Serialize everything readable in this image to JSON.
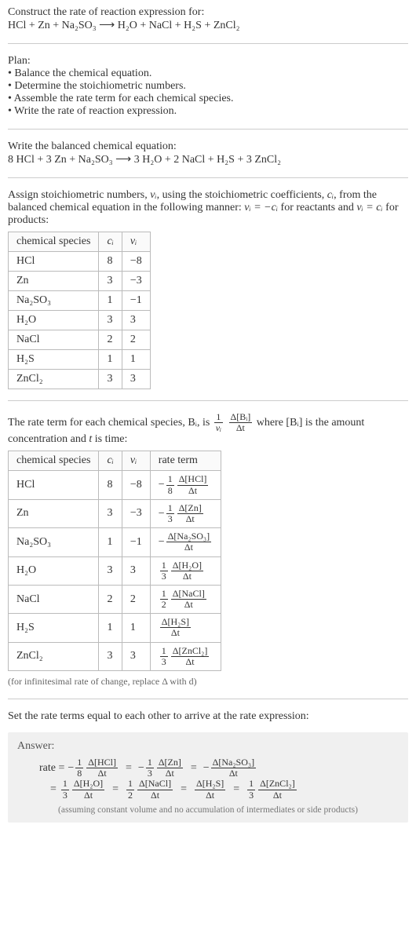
{
  "header": {
    "intro": "Construct the rate of reaction expression for:",
    "equation": "HCl + Zn + Na₂SO₃  ⟶  H₂O + NaCl + H₂S + ZnCl₂"
  },
  "plan": {
    "title": "Plan:",
    "items": [
      "• Balance the chemical equation.",
      "• Determine the stoichiometric numbers.",
      "• Assemble the rate term for each chemical species.",
      "• Write the rate of reaction expression."
    ]
  },
  "balanced": {
    "title": "Write the balanced chemical equation:",
    "equation": "8 HCl + 3 Zn + Na₂SO₃  ⟶  3 H₂O + 2 NaCl + H₂S + 3 ZnCl₂"
  },
  "stoich_text": {
    "line1a": "Assign stoichiometric numbers, ",
    "line1b": ", using the stoichiometric coefficients, ",
    "line1c": ", from the balanced chemical equation in the following manner: ",
    "line1d": " for reactants and ",
    "line1e": " for products:",
    "nu_i": "νᵢ",
    "c_i": "cᵢ",
    "eq1": "νᵢ = −cᵢ",
    "eq2": "νᵢ = cᵢ"
  },
  "table1": {
    "headers": [
      "chemical species",
      "cᵢ",
      "νᵢ"
    ],
    "rows": [
      {
        "sp": "HCl",
        "c": "8",
        "n": "−8"
      },
      {
        "sp": "Zn",
        "c": "3",
        "n": "−3"
      },
      {
        "sp": "Na₂SO₃",
        "c": "1",
        "n": "−1"
      },
      {
        "sp": "H₂O",
        "c": "3",
        "n": "3"
      },
      {
        "sp": "NaCl",
        "c": "2",
        "n": "2"
      },
      {
        "sp": "H₂S",
        "c": "1",
        "n": "1"
      },
      {
        "sp": "ZnCl₂",
        "c": "3",
        "n": "3"
      }
    ]
  },
  "rate_text": {
    "a": "The rate term for each chemical species, Bᵢ, is ",
    "b": " where [Bᵢ] is the amount concentration and ",
    "t": "t",
    "c": " is time:"
  },
  "rate_frac": {
    "outer_num": "1",
    "outer_den": "νᵢ",
    "inner_num": "Δ[Bᵢ]",
    "inner_den": "Δt"
  },
  "table2": {
    "headers": [
      "chemical species",
      "cᵢ",
      "νᵢ",
      "rate term"
    ],
    "rows": [
      {
        "sp": "HCl",
        "c": "8",
        "n": "−8",
        "sign": "−",
        "on": "1",
        "od": "8",
        "inum": "Δ[HCl]",
        "iden": "Δt"
      },
      {
        "sp": "Zn",
        "c": "3",
        "n": "−3",
        "sign": "−",
        "on": "1",
        "od": "3",
        "inum": "Δ[Zn]",
        "iden": "Δt"
      },
      {
        "sp": "Na₂SO₃",
        "c": "1",
        "n": "−1",
        "sign": "−",
        "on": "",
        "od": "",
        "inum": "Δ[Na₂SO₃]",
        "iden": "Δt"
      },
      {
        "sp": "H₂O",
        "c": "3",
        "n": "3",
        "sign": "",
        "on": "1",
        "od": "3",
        "inum": "Δ[H₂O]",
        "iden": "Δt"
      },
      {
        "sp": "NaCl",
        "c": "2",
        "n": "2",
        "sign": "",
        "on": "1",
        "od": "2",
        "inum": "Δ[NaCl]",
        "iden": "Δt"
      },
      {
        "sp": "H₂S",
        "c": "1",
        "n": "1",
        "sign": "",
        "on": "",
        "od": "",
        "inum": "Δ[H₂S]",
        "iden": "Δt"
      },
      {
        "sp": "ZnCl₂",
        "c": "3",
        "n": "3",
        "sign": "",
        "on": "1",
        "od": "3",
        "inum": "Δ[ZnCl₂]",
        "iden": "Δt"
      }
    ]
  },
  "inf_note": "(for infinitesimal rate of change, replace Δ with d)",
  "set_equal": "Set the rate terms equal to each other to arrive at the rate expression:",
  "answer": {
    "label": "Answer:",
    "lead": "rate =",
    "terms_top": [
      {
        "sign": "−",
        "on": "1",
        "od": "8",
        "inum": "Δ[HCl]",
        "iden": "Δt"
      },
      {
        "sign": "−",
        "on": "1",
        "od": "3",
        "inum": "Δ[Zn]",
        "iden": "Δt"
      },
      {
        "sign": "−",
        "on": "",
        "od": "",
        "inum": "Δ[Na₂SO₃]",
        "iden": "Δt"
      }
    ],
    "terms_bot": [
      {
        "sign": "",
        "on": "1",
        "od": "3",
        "inum": "Δ[H₂O]",
        "iden": "Δt"
      },
      {
        "sign": "",
        "on": "1",
        "od": "2",
        "inum": "Δ[NaCl]",
        "iden": "Δt"
      },
      {
        "sign": "",
        "on": "",
        "od": "",
        "inum": "Δ[H₂S]",
        "iden": "Δt"
      },
      {
        "sign": "",
        "on": "1",
        "od": "3",
        "inum": "Δ[ZnCl₂]",
        "iden": "Δt"
      }
    ],
    "subnote": "(assuming constant volume and no accumulation of intermediates or side products)"
  }
}
